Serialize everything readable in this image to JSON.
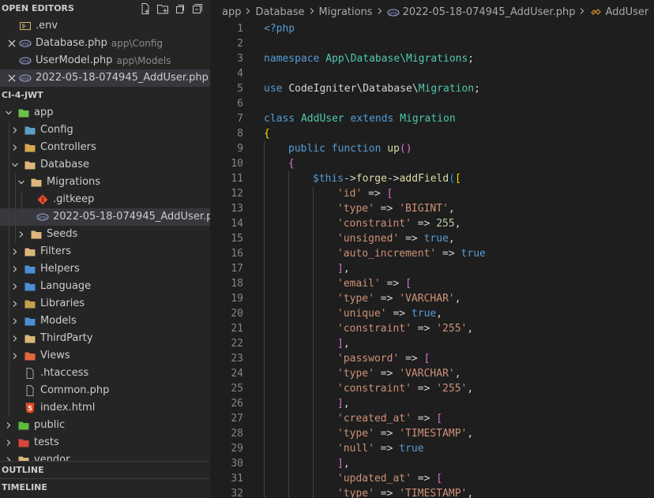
{
  "sidebar": {
    "open_editors_title": "OPEN EDITORS",
    "open_editors": [
      {
        "name": ".env",
        "desc": "",
        "icon": "env-file-icon",
        "closable": false,
        "active": false
      },
      {
        "name": "Database.php",
        "desc": "app\\Config",
        "icon": "php-file-icon",
        "closable": true,
        "active": false
      },
      {
        "name": "UserModel.php",
        "desc": "app\\Models",
        "icon": "php-file-icon",
        "closable": false,
        "active": false
      },
      {
        "name": "2022-05-18-074945_AddUser.php",
        "desc": "a...",
        "icon": "php-file-icon",
        "closable": true,
        "active": true
      }
    ],
    "project_title": "CI-4-JWT",
    "tree": [
      {
        "name": "app",
        "depth": 0,
        "type": "folder",
        "open": true,
        "icon": "app-folder-icon"
      },
      {
        "name": "Config",
        "depth": 1,
        "type": "folder",
        "open": false,
        "icon": "config-folder-icon"
      },
      {
        "name": "Controllers",
        "depth": 1,
        "type": "folder",
        "open": false,
        "icon": "controllers-folder-icon"
      },
      {
        "name": "Database",
        "depth": 1,
        "type": "folder",
        "open": true,
        "icon": "database-folder-icon"
      },
      {
        "name": "Migrations",
        "depth": 2,
        "type": "folder",
        "open": true,
        "icon": "folder-icon"
      },
      {
        "name": ".gitkeep",
        "depth": 3,
        "type": "file",
        "icon": "git-file-icon"
      },
      {
        "name": "2022-05-18-074945_AddUser.php",
        "depth": 3,
        "type": "file",
        "icon": "php-file-icon",
        "active": true
      },
      {
        "name": "Seeds",
        "depth": 2,
        "type": "folder",
        "open": false,
        "icon": "folder-icon"
      },
      {
        "name": "Filters",
        "depth": 1,
        "type": "folder",
        "open": false,
        "icon": "folder-icon"
      },
      {
        "name": "Helpers",
        "depth": 1,
        "type": "folder",
        "open": false,
        "icon": "helpers-folder-icon"
      },
      {
        "name": "Language",
        "depth": 1,
        "type": "folder",
        "open": false,
        "icon": "language-folder-icon"
      },
      {
        "name": "Libraries",
        "depth": 1,
        "type": "folder",
        "open": false,
        "icon": "libraries-folder-icon"
      },
      {
        "name": "Models",
        "depth": 1,
        "type": "folder",
        "open": false,
        "icon": "models-folder-icon"
      },
      {
        "name": "ThirdParty",
        "depth": 1,
        "type": "folder",
        "open": false,
        "icon": "folder-icon"
      },
      {
        "name": "Views",
        "depth": 1,
        "type": "folder",
        "open": false,
        "icon": "views-folder-icon"
      },
      {
        "name": ".htaccess",
        "depth": 1,
        "type": "file",
        "icon": "file-icon"
      },
      {
        "name": "Common.php",
        "depth": 1,
        "type": "file",
        "icon": "file-icon"
      },
      {
        "name": "index.html",
        "depth": 1,
        "type": "file",
        "icon": "html-file-icon"
      },
      {
        "name": "public",
        "depth": 0,
        "type": "folder",
        "open": false,
        "icon": "public-folder-icon"
      },
      {
        "name": "tests",
        "depth": 0,
        "type": "folder",
        "open": false,
        "icon": "tests-folder-icon"
      },
      {
        "name": "vendor",
        "depth": 0,
        "type": "folder",
        "open": false,
        "icon": "folder-icon"
      }
    ],
    "outline_title": "OUTLINE",
    "timeline_title": "TIMELINE"
  },
  "breadcrumb": [
    {
      "label": "app",
      "icon": ""
    },
    {
      "label": "Database",
      "icon": ""
    },
    {
      "label": "Migrations",
      "icon": ""
    },
    {
      "label": "2022-05-18-074945_AddUser.php",
      "icon": "php-file-icon"
    },
    {
      "label": "AddUser",
      "icon": "class-symbol-icon"
    },
    {
      "label": "up",
      "icon": "method-symbol-icon"
    }
  ],
  "colors": {
    "sidebar_bg": "#252526",
    "editor_bg": "#1e1e1e",
    "active_row": "#37373d",
    "php_icon": "#8993be",
    "folder": "#dcb67a"
  },
  "code": [
    {
      "n": "1",
      "indent": 0,
      "tokens": [
        [
          "tag",
          "<?php"
        ]
      ]
    },
    {
      "n": "2",
      "indent": 0,
      "tokens": []
    },
    {
      "n": "3",
      "indent": 0,
      "tokens": [
        [
          "kw",
          "namespace "
        ],
        [
          "ns",
          "App\\Database\\Migrations"
        ],
        [
          "pl",
          ";"
        ]
      ]
    },
    {
      "n": "4",
      "indent": 0,
      "tokens": []
    },
    {
      "n": "5",
      "indent": 0,
      "tokens": [
        [
          "kw",
          "use "
        ],
        [
          "pl",
          "CodeIgniter\\Database\\"
        ],
        [
          "type",
          "Migration"
        ],
        [
          "pl",
          ";"
        ]
      ]
    },
    {
      "n": "6",
      "indent": 0,
      "tokens": []
    },
    {
      "n": "7",
      "indent": 0,
      "tokens": [
        [
          "kw",
          "class "
        ],
        [
          "type",
          "AddUser"
        ],
        [
          "pl",
          " "
        ],
        [
          "kw",
          "extends "
        ],
        [
          "type",
          "Migration"
        ]
      ]
    },
    {
      "n": "8",
      "indent": 0,
      "tokens": [
        [
          "b1",
          "{"
        ]
      ]
    },
    {
      "n": "9",
      "indent": 1,
      "tokens": [
        [
          "kw",
          "public "
        ],
        [
          "kw",
          "function "
        ],
        [
          "fn",
          "up"
        ],
        [
          "b2",
          "()"
        ]
      ]
    },
    {
      "n": "10",
      "indent": 1,
      "tokens": [
        [
          "b2",
          "{"
        ]
      ]
    },
    {
      "n": "11",
      "indent": 2,
      "tokens": [
        [
          "this",
          "$this"
        ],
        [
          "pl",
          "->"
        ],
        [
          "fn",
          "forge"
        ],
        [
          "pl",
          "->"
        ],
        [
          "fn",
          "addField"
        ],
        [
          "b3",
          "("
        ],
        [
          "b1",
          "["
        ]
      ]
    },
    {
      "n": "12",
      "indent": 3,
      "tokens": [
        [
          "str",
          "'id'"
        ],
        [
          "pl",
          " => "
        ],
        [
          "b2",
          "["
        ]
      ]
    },
    {
      "n": "13",
      "indent": 3,
      "tokens": [
        [
          "str",
          "'type'"
        ],
        [
          "pl",
          " => "
        ],
        [
          "str",
          "'BIGINT'"
        ],
        [
          "pl",
          ","
        ]
      ]
    },
    {
      "n": "14",
      "indent": 3,
      "tokens": [
        [
          "str",
          "'constraint'"
        ],
        [
          "pl",
          " => "
        ],
        [
          "num",
          "255"
        ],
        [
          "pl",
          ","
        ]
      ]
    },
    {
      "n": "15",
      "indent": 3,
      "tokens": [
        [
          "str",
          "'unsigned'"
        ],
        [
          "pl",
          " => "
        ],
        [
          "kw",
          "true"
        ],
        [
          "pl",
          ","
        ]
      ]
    },
    {
      "n": "16",
      "indent": 3,
      "tokens": [
        [
          "str",
          "'auto_increment'"
        ],
        [
          "pl",
          " => "
        ],
        [
          "kw",
          "true"
        ]
      ]
    },
    {
      "n": "17",
      "indent": 3,
      "tokens": [
        [
          "b2",
          "]"
        ],
        [
          "pl",
          ","
        ]
      ]
    },
    {
      "n": "18",
      "indent": 3,
      "tokens": [
        [
          "str",
          "'email'"
        ],
        [
          "pl",
          " => "
        ],
        [
          "b2",
          "["
        ]
      ]
    },
    {
      "n": "19",
      "indent": 3,
      "tokens": [
        [
          "str",
          "'type'"
        ],
        [
          "pl",
          " => "
        ],
        [
          "str",
          "'VARCHAR'"
        ],
        [
          "pl",
          ","
        ]
      ]
    },
    {
      "n": "20",
      "indent": 3,
      "tokens": [
        [
          "str",
          "'unique'"
        ],
        [
          "pl",
          " => "
        ],
        [
          "kw",
          "true"
        ],
        [
          "pl",
          ","
        ]
      ]
    },
    {
      "n": "21",
      "indent": 3,
      "tokens": [
        [
          "str",
          "'constraint'"
        ],
        [
          "pl",
          " => "
        ],
        [
          "str",
          "'255'"
        ],
        [
          "pl",
          ","
        ]
      ]
    },
    {
      "n": "22",
      "indent": 3,
      "tokens": [
        [
          "b2",
          "]"
        ],
        [
          "pl",
          ","
        ]
      ]
    },
    {
      "n": "23",
      "indent": 3,
      "tokens": [
        [
          "str",
          "'password'"
        ],
        [
          "pl",
          " => "
        ],
        [
          "b2",
          "["
        ]
      ]
    },
    {
      "n": "24",
      "indent": 3,
      "tokens": [
        [
          "str",
          "'type'"
        ],
        [
          "pl",
          " => "
        ],
        [
          "str",
          "'VARCHAR'"
        ],
        [
          "pl",
          ","
        ]
      ]
    },
    {
      "n": "25",
      "indent": 3,
      "tokens": [
        [
          "str",
          "'constraint'"
        ],
        [
          "pl",
          " => "
        ],
        [
          "str",
          "'255'"
        ],
        [
          "pl",
          ","
        ]
      ]
    },
    {
      "n": "26",
      "indent": 3,
      "tokens": [
        [
          "b2",
          "]"
        ],
        [
          "pl",
          ","
        ]
      ]
    },
    {
      "n": "27",
      "indent": 3,
      "tokens": [
        [
          "str",
          "'created_at'"
        ],
        [
          "pl",
          " => "
        ],
        [
          "b2",
          "["
        ]
      ]
    },
    {
      "n": "28",
      "indent": 3,
      "tokens": [
        [
          "str",
          "'type'"
        ],
        [
          "pl",
          " => "
        ],
        [
          "str",
          "'TIMESTAMP'"
        ],
        [
          "pl",
          ","
        ]
      ]
    },
    {
      "n": "29",
      "indent": 3,
      "tokens": [
        [
          "str",
          "'null'"
        ],
        [
          "pl",
          " => "
        ],
        [
          "kw",
          "true"
        ]
      ]
    },
    {
      "n": "30",
      "indent": 3,
      "tokens": [
        [
          "b2",
          "]"
        ],
        [
          "pl",
          ","
        ]
      ]
    },
    {
      "n": "31",
      "indent": 3,
      "tokens": [
        [
          "str",
          "'updated_at'"
        ],
        [
          "pl",
          " => "
        ],
        [
          "b2",
          "["
        ]
      ]
    },
    {
      "n": "32",
      "indent": 3,
      "tokens": [
        [
          "str",
          "'type'"
        ],
        [
          "pl",
          " => "
        ],
        [
          "str",
          "'TIMESTAMP'"
        ],
        [
          "pl",
          ","
        ]
      ]
    }
  ]
}
